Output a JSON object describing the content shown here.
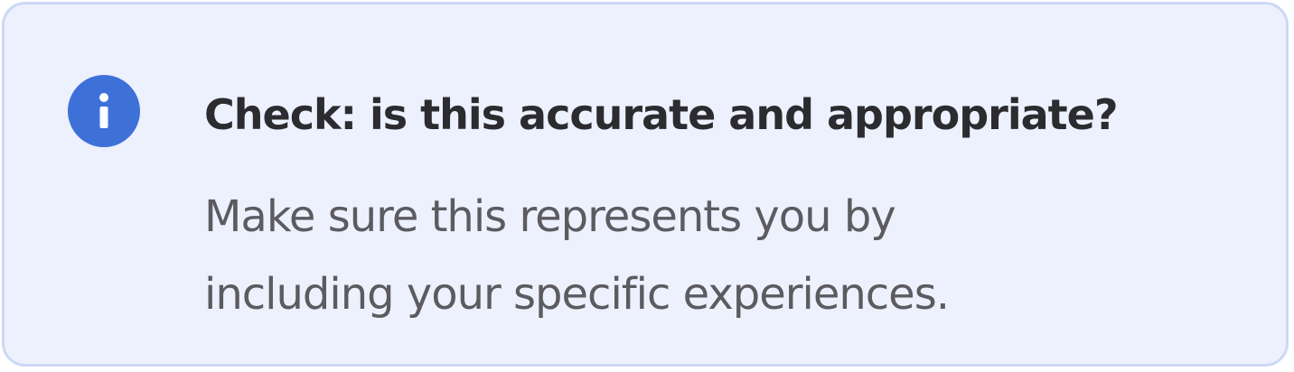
{
  "notice": {
    "icon": "info-icon",
    "title": "Check: is this accurate and appropriate?",
    "body_lines": [
      "Make sure this represents you by",
      "including your specific experiences."
    ]
  },
  "colors": {
    "background": "#edf1fe",
    "border": "#cdd8f6",
    "icon": "#3e71d8",
    "title": "#2c2c30",
    "body": "#5b5b60"
  }
}
